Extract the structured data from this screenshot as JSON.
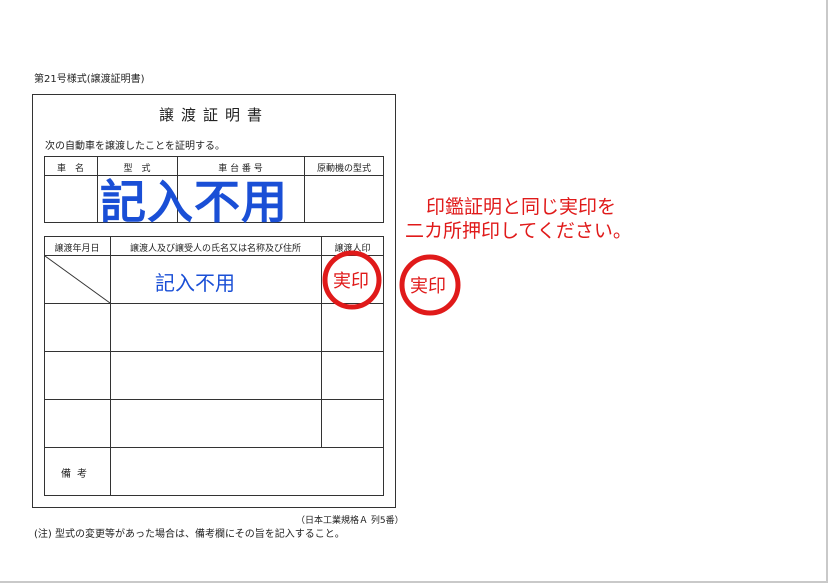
{
  "form": {
    "number": "第21号様式(譲渡証明書)",
    "title": "譲渡証明書",
    "statement": "次の自動車を譲渡したことを証明する。",
    "vehicle_headers": [
      "車　名",
      "型　式",
      "車 台 番 号",
      "原動機の型式"
    ],
    "transfer_headers": [
      "譲渡年月日",
      "譲渡人及び譲受人の氏名又は名称及び住所",
      "譲渡人印"
    ],
    "remarks_label": "備考",
    "jis_note": "（日本工業規格Ａ 列5番）",
    "footnote": "(注) 型式の変更等があった場合は、備考欄にその旨を記入すること。"
  },
  "annotations": {
    "no_fill_large": "記入不用",
    "no_fill_small": "記入不用",
    "instruction_line1": "印鑑証明と同じ実印を",
    "instruction_line2": "二カ所押印してください。",
    "seal_label_1": "実印",
    "seal_label_2": "実印",
    "accent_blue": "#1a4fd6",
    "accent_red": "#e01a1a"
  }
}
